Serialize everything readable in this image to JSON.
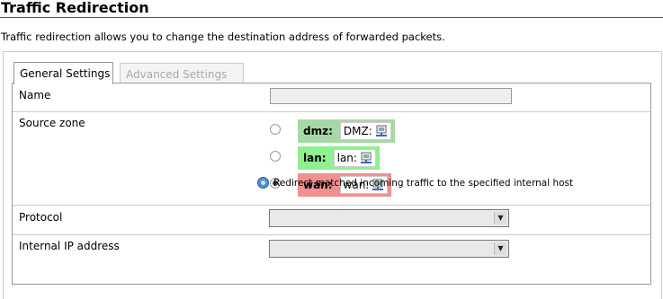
{
  "page": {
    "title": "Traffic Redirection",
    "description": "Traffic redirection allows you to change the destination address of forwarded packets."
  },
  "tabs": [
    {
      "label": "General Settings",
      "active": true
    },
    {
      "label": "Advanced Settings",
      "active": false
    }
  ],
  "form": {
    "name": {
      "label": "Name",
      "value": ""
    },
    "source_zone": {
      "label": "Source zone",
      "zones": [
        {
          "name": "dmz:",
          "network": "DMZ:",
          "color": "#a6d9a6",
          "selected": false,
          "icon": "network-icon"
        },
        {
          "name": "lan:",
          "network": "lan:",
          "color": "#90f090",
          "selected": false,
          "icon": "network-icon"
        },
        {
          "name": "wan:",
          "network": "wan:",
          "color": "#f09090",
          "selected": true,
          "icon": "network-icon"
        }
      ]
    },
    "protocol": {
      "label": "Protocol",
      "value": ""
    },
    "internal_ip": {
      "label": "Internal IP address",
      "value": "",
      "hint": "Redirect matched incoming traffic to the specified internal host"
    }
  }
}
